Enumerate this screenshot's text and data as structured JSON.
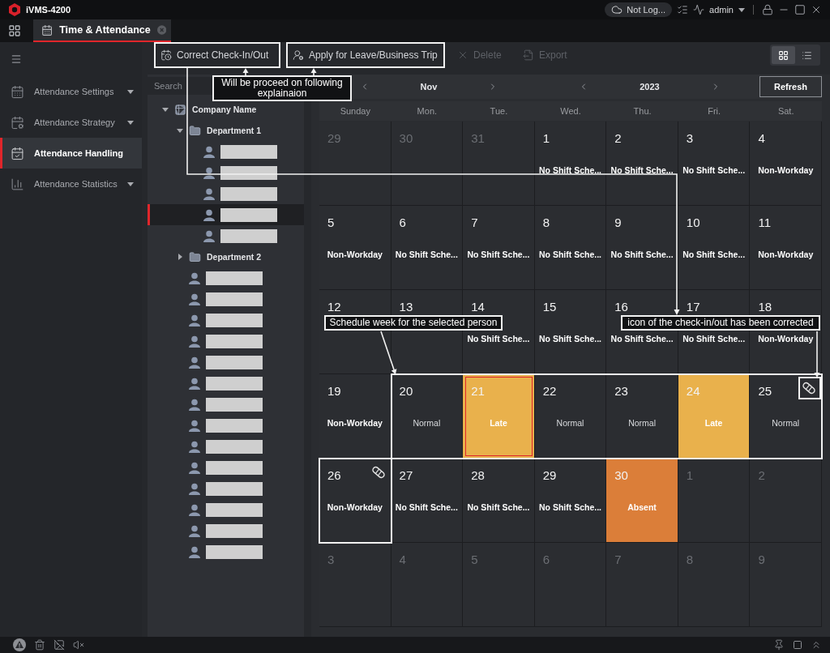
{
  "app": {
    "title": "iVMS-4200"
  },
  "title_bar": {
    "cloud_status": "Not Log...",
    "user": "admin"
  },
  "tabs": [
    {
      "label": "Time & Attendance",
      "selected": true
    }
  ],
  "sidebar": {
    "items": [
      {
        "label": "Attendance Settings",
        "kind": "settings",
        "selected": false,
        "has_submenu": true
      },
      {
        "label": "Attendance Strategy",
        "kind": "strategy",
        "selected": false,
        "has_submenu": true
      },
      {
        "label": "Attendance Handling",
        "kind": "handling",
        "selected": true,
        "has_submenu": false
      },
      {
        "label": "Attendance Statistics",
        "kind": "statistics",
        "selected": false,
        "has_submenu": true
      }
    ]
  },
  "toolbar": {
    "buttons": [
      {
        "kind": "correct",
        "label": "Correct Check-In/Out",
        "disabled": false
      },
      {
        "kind": "leave",
        "label": "Apply for Leave/Business Trip",
        "disabled": false
      },
      {
        "kind": "delete",
        "label": "Delete",
        "disabled": true
      },
      {
        "kind": "export",
        "label": "Export",
        "disabled": true
      }
    ],
    "views": [
      {
        "kind": "grid",
        "selected": true
      },
      {
        "kind": "list",
        "selected": false
      }
    ]
  },
  "tree": {
    "search": {
      "placeholder": "Search"
    },
    "nodes": [
      {
        "kind": "org",
        "label": "Company Name",
        "expanded": true,
        "children": [
          {
            "kind": "dept",
            "label": "Department 1",
            "expanded": true,
            "children": [
              {
                "kind": "person",
                "selected": false
              },
              {
                "kind": "person",
                "selected": false
              },
              {
                "kind": "person",
                "selected": false
              },
              {
                "kind": "person",
                "selected": true
              },
              {
                "kind": "person",
                "selected": false
              }
            ]
          },
          {
            "kind": "dept",
            "label": "Department 2",
            "expanded": false
          },
          {
            "kind": "person",
            "selected": false
          },
          {
            "kind": "person",
            "selected": false
          },
          {
            "kind": "person",
            "selected": false
          },
          {
            "kind": "person",
            "selected": false
          },
          {
            "kind": "person",
            "selected": false
          },
          {
            "kind": "person",
            "selected": false
          },
          {
            "kind": "person",
            "selected": false
          },
          {
            "kind": "person",
            "selected": false
          },
          {
            "kind": "person",
            "selected": false
          },
          {
            "kind": "person",
            "selected": false
          },
          {
            "kind": "person",
            "selected": false
          },
          {
            "kind": "person",
            "selected": false
          },
          {
            "kind": "person",
            "selected": false
          },
          {
            "kind": "person",
            "selected": false
          }
        ]
      }
    ]
  },
  "calendar": {
    "month": "Nov",
    "year": "2023",
    "refresh": "Refresh",
    "weekdays": [
      "Sunday",
      "Mon.",
      "Tue.",
      "Wed.",
      "Thu.",
      "Fri.",
      "Sat."
    ],
    "weeks": [
      [
        {
          "day": "29",
          "muted": true,
          "kind": "empty",
          "selected": false
        },
        {
          "day": "30",
          "muted": true,
          "kind": "empty",
          "selected": false
        },
        {
          "day": "31",
          "muted": true,
          "kind": "empty",
          "selected": false
        },
        {
          "day": "1",
          "muted": false,
          "kind": "info",
          "status": "No Shift Sche...",
          "selected": false
        },
        {
          "day": "2",
          "muted": false,
          "kind": "info",
          "status": "No Shift Sche...",
          "selected": false
        },
        {
          "day": "3",
          "muted": false,
          "kind": "info",
          "status": "No Shift Sche...",
          "selected": false
        },
        {
          "day": "4",
          "muted": false,
          "kind": "info",
          "status": "Non-Workday",
          "selected": false
        }
      ],
      [
        {
          "day": "5",
          "muted": false,
          "kind": "info",
          "status": "Non-Workday",
          "selected": false
        },
        {
          "day": "6",
          "muted": false,
          "kind": "info",
          "status": "No Shift Sche...",
          "selected": false
        },
        {
          "day": "7",
          "muted": false,
          "kind": "info",
          "status": "No Shift Sche...",
          "selected": false
        },
        {
          "day": "8",
          "muted": false,
          "kind": "info",
          "status": "No Shift Sche...",
          "selected": false
        },
        {
          "day": "9",
          "muted": false,
          "kind": "info",
          "status": "No Shift Sche...",
          "selected": false
        },
        {
          "day": "10",
          "muted": false,
          "kind": "info",
          "status": "No Shift Sche...",
          "selected": false
        },
        {
          "day": "11",
          "muted": false,
          "kind": "info",
          "status": "Non-Workday",
          "selected": false
        }
      ],
      [
        {
          "day": "12",
          "muted": false,
          "kind": "empty",
          "selected": false
        },
        {
          "day": "13",
          "muted": false,
          "kind": "empty",
          "selected": false
        },
        {
          "day": "14",
          "muted": false,
          "kind": "info",
          "status": "No Shift Sche...",
          "selected": false
        },
        {
          "day": "15",
          "muted": false,
          "kind": "info",
          "status": "No Shift Sche...",
          "selected": false
        },
        {
          "day": "16",
          "muted": false,
          "kind": "info",
          "status": "No Shift Sche...",
          "selected": false
        },
        {
          "day": "17",
          "muted": false,
          "kind": "info",
          "status": "No Shift Sche...",
          "selected": false
        },
        {
          "day": "18",
          "muted": false,
          "kind": "info",
          "status": "Non-Workday",
          "selected": false
        }
      ],
      [
        {
          "day": "19",
          "muted": false,
          "kind": "info",
          "status": "Non-Workday",
          "selected": false
        },
        {
          "day": "20",
          "muted": false,
          "kind": "normal",
          "status": "Normal",
          "selected": false
        },
        {
          "day": "21",
          "muted": false,
          "kind": "late",
          "status": "Late",
          "selected": true
        },
        {
          "day": "22",
          "muted": false,
          "kind": "normal",
          "status": "Normal",
          "selected": false
        },
        {
          "day": "23",
          "muted": false,
          "kind": "normal",
          "status": "Normal",
          "selected": false
        },
        {
          "day": "24",
          "muted": false,
          "kind": "late",
          "status": "Late",
          "selected": false
        },
        {
          "day": "25",
          "muted": false,
          "kind": "normal",
          "status": "Normal",
          "corrected": true,
          "selected": false
        }
      ],
      [
        {
          "day": "26",
          "muted": false,
          "kind": "info",
          "status": "Non-Workday",
          "corrected": true,
          "selected": false
        },
        {
          "day": "27",
          "muted": false,
          "kind": "info",
          "status": "No Shift Sche...",
          "selected": false
        },
        {
          "day": "28",
          "muted": false,
          "kind": "info",
          "status": "No Shift Sche...",
          "selected": false
        },
        {
          "day": "29",
          "muted": false,
          "kind": "info",
          "status": "No Shift Sche...",
          "selected": false
        },
        {
          "day": "30",
          "muted": false,
          "kind": "absent",
          "status": "Absent",
          "selected": false
        },
        {
          "day": "1",
          "muted": true,
          "kind": "empty",
          "selected": false
        },
        {
          "day": "2",
          "muted": true,
          "kind": "empty",
          "selected": false
        }
      ],
      [
        {
          "day": "3",
          "muted": true,
          "kind": "empty",
          "selected": false
        },
        {
          "day": "4",
          "muted": true,
          "kind": "empty",
          "selected": false
        },
        {
          "day": "5",
          "muted": true,
          "kind": "empty",
          "selected": false
        },
        {
          "day": "6",
          "muted": true,
          "kind": "empty",
          "selected": false
        },
        {
          "day": "7",
          "muted": true,
          "kind": "empty",
          "selected": false
        },
        {
          "day": "8",
          "muted": true,
          "kind": "empty",
          "selected": false
        },
        {
          "day": "9",
          "muted": true,
          "kind": "empty",
          "selected": false
        }
      ]
    ]
  },
  "annotations": [
    {
      "text": "Will be proceed on following explainaion"
    },
    {
      "text": "Schedule week for the selected person"
    },
    {
      "text": "icon of the check-in/out has been corrected"
    }
  ]
}
